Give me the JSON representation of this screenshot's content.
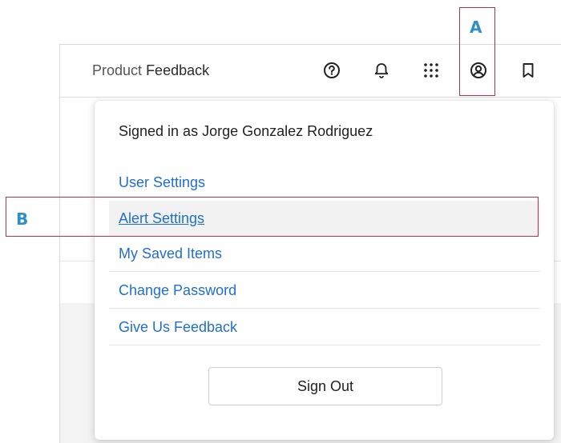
{
  "callouts": {
    "a": "A",
    "b": "B"
  },
  "header": {
    "title_light": "Product",
    "title_strong": "Feedback",
    "icons": [
      "help-icon",
      "bell-icon",
      "apps-grid-icon",
      "account-icon",
      "bookmark-icon"
    ]
  },
  "menu": {
    "signed_in": "Signed in as Jorge Gonzalez Rodriguez",
    "items": [
      {
        "label": "User Settings"
      },
      {
        "label": "Alert Settings"
      },
      {
        "label": "My Saved Items"
      },
      {
        "label": "Change Password"
      },
      {
        "label": "Give Us Feedback"
      }
    ],
    "sign_out": "Sign Out"
  },
  "colors": {
    "link": "#1f6fd0",
    "callout_label": "#2f8fc7",
    "callout_border": "#b5334c"
  }
}
